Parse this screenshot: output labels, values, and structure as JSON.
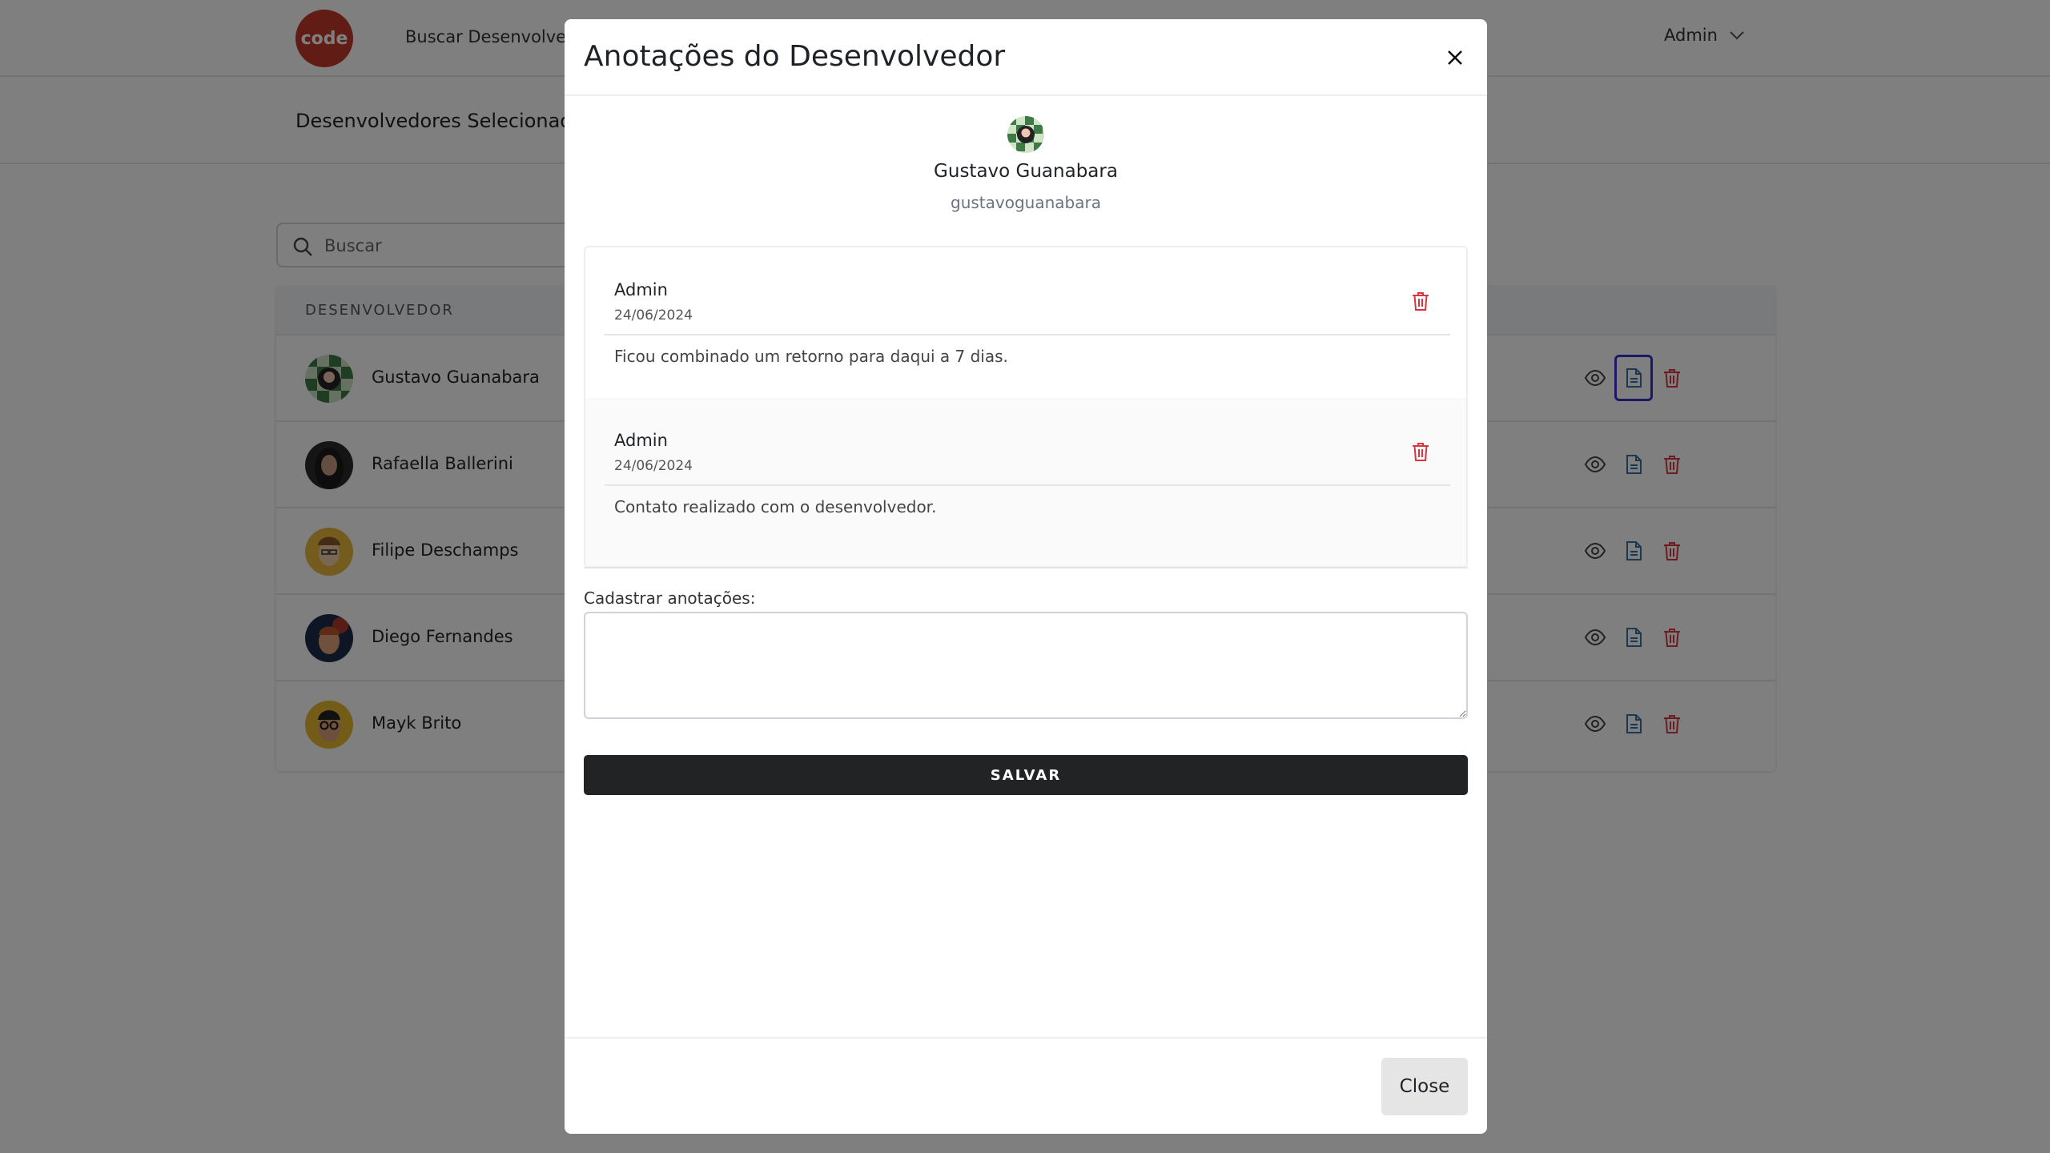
{
  "navbar": {
    "logo_text": "code",
    "search_link": "Buscar Desenvolvedores",
    "user_menu": "Admin",
    "brand_color": "#c0392b"
  },
  "subheader": {
    "title": "Desenvolvedores Selecionados"
  },
  "search": {
    "placeholder": "Buscar",
    "value": ""
  },
  "table": {
    "column_header": "DESENVOLVEDOR",
    "rows": [
      {
        "name": "Gustavo Guanabara"
      },
      {
        "name": "Rafaella Ballerini"
      },
      {
        "name": "Filipe Deschamps"
      },
      {
        "name": "Diego Fernandes"
      },
      {
        "name": "Mayk Brito"
      }
    ],
    "action_icons": [
      "eye-icon",
      "document-icon",
      "trash-icon"
    ]
  },
  "modal": {
    "title": "Anotações do Desenvolvedor",
    "developer": {
      "name": "Gustavo Guanabara",
      "username": "gustavoguanabara"
    },
    "notes": [
      {
        "author": "Admin",
        "date": "24/06/2024",
        "text": "Ficou combinado um retorno para daqui a 7 dias."
      },
      {
        "author": "Admin",
        "date": "24/06/2024",
        "text": "Contato realizado com o desenvolvedor."
      }
    ],
    "form_label": "Cadastrar anotações:",
    "textarea_value": "",
    "save_label": "SALVAR",
    "close_label": "Close"
  },
  "colors": {
    "danger": "#d9363e",
    "document_icon": "#3b6fa3",
    "focus_ring": "#3b2fd1",
    "save_button_bg": "#212325"
  }
}
